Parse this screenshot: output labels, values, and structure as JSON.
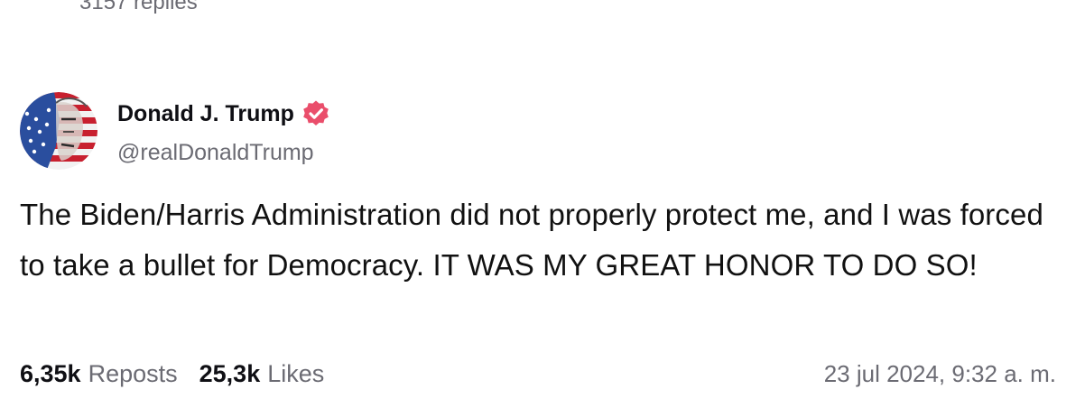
{
  "thread": {
    "previous_replies_label": "3157 replies"
  },
  "post": {
    "author": {
      "display_name": "Donald J. Trump",
      "handle": "@realDonaldTrump",
      "verified": true,
      "verified_color": "#ea4e6b",
      "avatar_icon": "flag-portrait-avatar"
    },
    "text": "The Biden/Harris Administration did not properly protect me, and I was forced to take a bullet for Democracy. IT WAS MY GREAT HONOR TO DO SO!",
    "stats": {
      "reposts_count": "6,35k",
      "reposts_label": "Reposts",
      "likes_count": "25,3k",
      "likes_label": "Likes"
    },
    "timestamp": "23 jul 2024, 9:32 a. m."
  },
  "colors": {
    "text_primary": "#111111",
    "text_secondary": "#6b6b73",
    "background": "#ffffff"
  }
}
